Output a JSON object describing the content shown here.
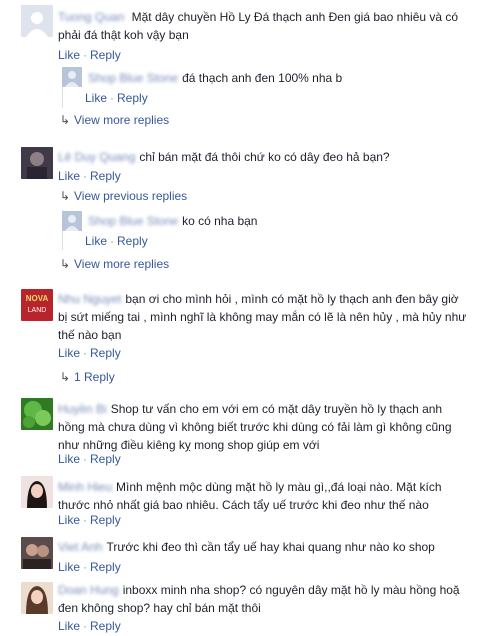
{
  "actions": {
    "like": "Like",
    "reply": "Reply",
    "sep": "·"
  },
  "comments": [
    {
      "author": "Tuong Quan",
      "text_1": "Mặt dây chuyền Hồ Ly Đá thạch anh Đen giá bao nhiêu và có",
      "text_2": "phải đá thật koh vậy bạn",
      "reply": {
        "author": "Shop Blue Stone",
        "text": "đá thạch anh đen 100% nha b"
      },
      "more": "View more replies"
    },
    {
      "author": "Lê Duy Quang",
      "text_1": "chỉ bán mặt đá thôi chứ ko có dây đeo hả bạn?",
      "previous": "View previous replies",
      "reply": {
        "author": "Shop Blue Stone",
        "text": "ko có nha bạn"
      },
      "more": "View more replies"
    },
    {
      "author": "Nhu Nguyet",
      "avatar_text": "NOVA",
      "avatar_sub": "LAND",
      "text_1": "bạn ơi cho mình hỏi , mình có mặt hồ ly thạch anh đen bây giờ",
      "text_2": "bị sứt miếng tai , mình nghĩ là không may mắn có lẽ là nên hủy , mà hủy như",
      "text_3": "thế nào bạn",
      "more": "1 Reply"
    },
    {
      "author": "Huyền Bi",
      "text_1": "Shop tư vấn cho em với em có mặt dây truyền hồ ly thạch anh",
      "text_2": "hồng mà chưa dùng vì không biết trước khi dùng có fải làm gì không cũng",
      "text_3": "như những điều kiêng kỵ mong shop giúp em với"
    },
    {
      "author": "Minh Hieu",
      "text_1": "Mình mệnh mộc dùng mặt hồ ly màu gì,,đá loại nào. Mặt kích",
      "text_2": "thước nhỏ nhất giá bao nhiêu. Cách tẩy uế trước khi đeo như thế nào"
    },
    {
      "author": "Viet Anh",
      "text_1": "Trước khi đeo thì cần tẩy uế hay khai quang như nào ko shop"
    },
    {
      "author": "Doan Hung",
      "text_1": "inboxx minh nha shop? có nguyên dây mặt hồ ly màu hồng hoặ",
      "text_2": "đen không shop? hay chỉ bán mặt thôi"
    }
  ]
}
